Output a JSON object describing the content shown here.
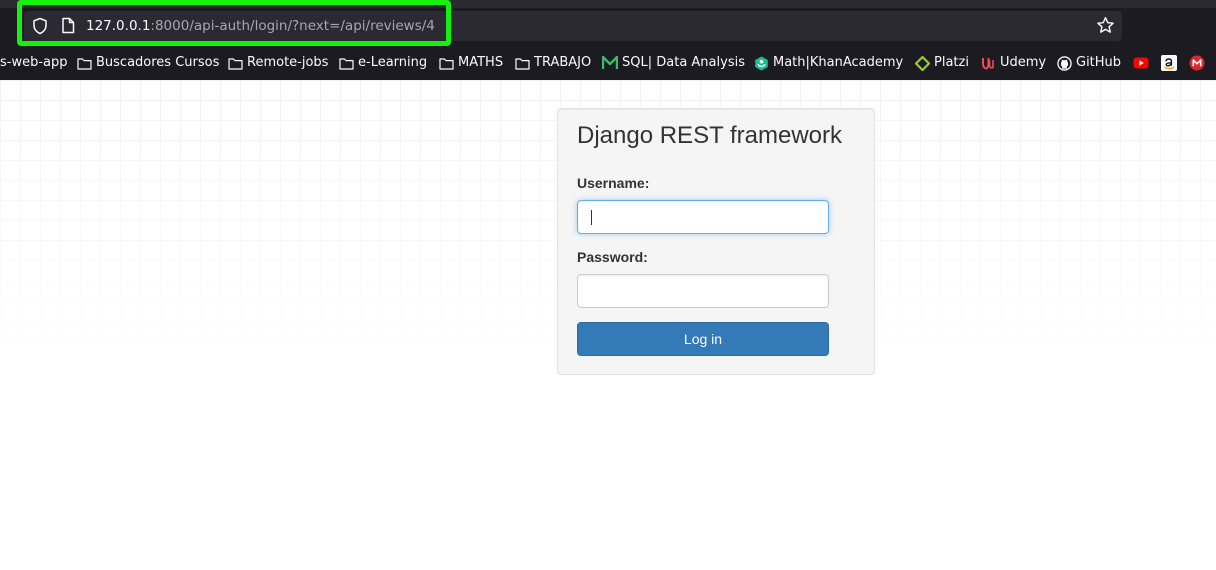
{
  "browser": {
    "url": {
      "host": "127.0.0.1",
      "rest": ":8000/api-auth/login/?next=/api/reviews/4"
    },
    "icons": {
      "security": "shield-icon",
      "page": "page-icon",
      "bookmark_star": "star-icon"
    },
    "highlight_color": "#15f00f"
  },
  "bookmarks": [
    {
      "label": "s-web-app",
      "icon": "none"
    },
    {
      "label": "Buscadores Cursos",
      "icon": "folder-icon"
    },
    {
      "label": "Remote-jobs",
      "icon": "folder-icon"
    },
    {
      "label": "e-Learning",
      "icon": "folder-icon"
    },
    {
      "label": "MATHS",
      "icon": "folder-icon"
    },
    {
      "label": "TRABAJO",
      "icon": "folder-icon"
    },
    {
      "label": "SQL| Data Analysis",
      "icon": "m-logo-icon"
    },
    {
      "label": "Math|KhanAcademy",
      "icon": "khan-academy-icon"
    },
    {
      "label": "Platzi",
      "icon": "platzi-icon"
    },
    {
      "label": "Udemy",
      "icon": "udemy-icon"
    },
    {
      "label": "GitHub",
      "icon": "github-icon"
    },
    {
      "label": "",
      "icon": "youtube-icon"
    },
    {
      "label": "",
      "icon": "amazon-icon"
    },
    {
      "label": "",
      "icon": "mega-icon"
    }
  ],
  "login": {
    "title": "Django REST framework",
    "username_label": "Username:",
    "username_value": "",
    "password_label": "Password:",
    "password_value": "",
    "submit_label": "Log in",
    "colors": {
      "button": "#337ab7",
      "well": "#f5f5f5",
      "focus_border": "#66afe9"
    }
  }
}
